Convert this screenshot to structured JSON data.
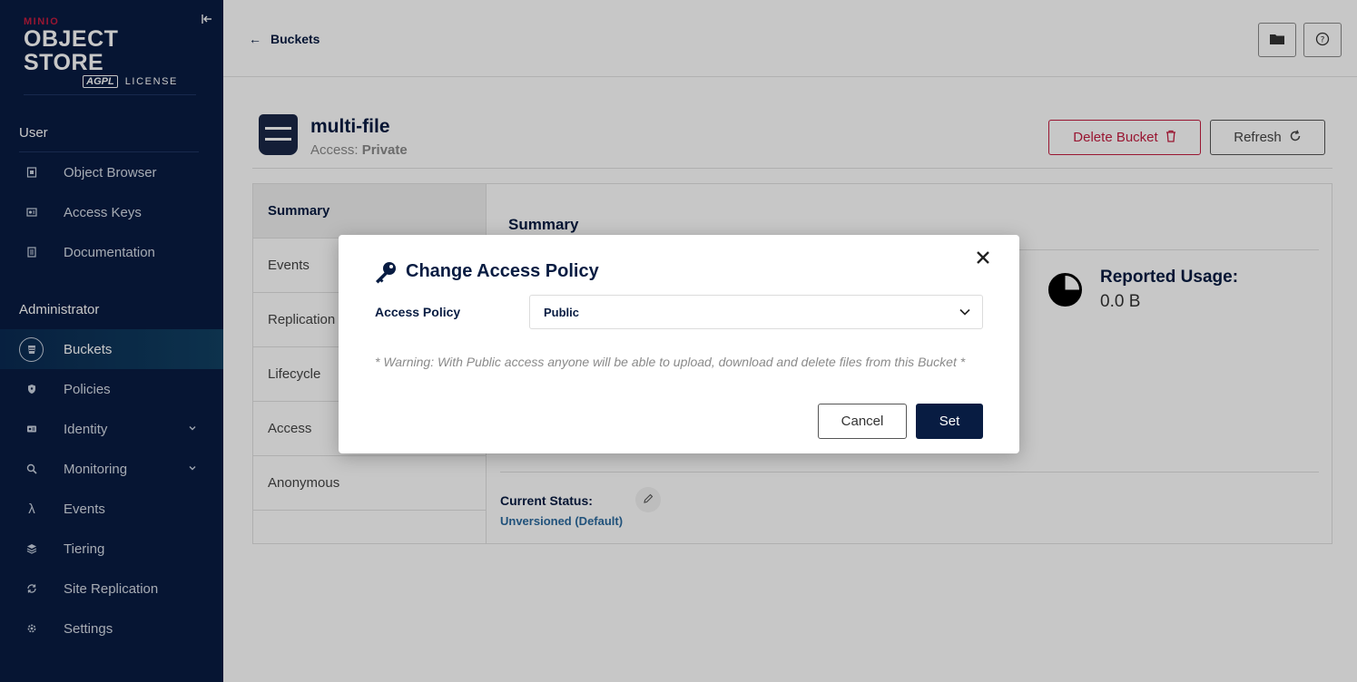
{
  "logo": {
    "brand": "MINIO",
    "product": "OBJECT STORE",
    "license_badge": "AGPL",
    "license_label": "LICENSE"
  },
  "sidebar": {
    "user_section": "User",
    "user_items": [
      {
        "label": "Object Browser",
        "icon": "object-browser-icon"
      },
      {
        "label": "Access Keys",
        "icon": "access-keys-icon"
      },
      {
        "label": "Documentation",
        "icon": "documentation-icon"
      }
    ],
    "admin_section": "Administrator",
    "admin_items": [
      {
        "label": "Buckets",
        "icon": "bucket-icon",
        "active": true
      },
      {
        "label": "Policies",
        "icon": "shield-icon"
      },
      {
        "label": "Identity",
        "icon": "identity-icon",
        "expandable": true
      },
      {
        "label": "Monitoring",
        "icon": "monitoring-icon",
        "expandable": true
      },
      {
        "label": "Events",
        "icon": "lambda-icon"
      },
      {
        "label": "Tiering",
        "icon": "tiers-icon"
      },
      {
        "label": "Site Replication",
        "icon": "replication-icon"
      },
      {
        "label": "Settings",
        "icon": "gear-icon"
      }
    ]
  },
  "topbar": {
    "back_label": "Buckets"
  },
  "bucket": {
    "name": "multi-file",
    "access_label": "Access:",
    "access_value": "Private",
    "delete_label": "Delete Bucket",
    "refresh_label": "Refresh"
  },
  "tabs": [
    "Summary",
    "Events",
    "Replication",
    "Lifecycle",
    "Access",
    "Anonymous"
  ],
  "summary": {
    "title": "Summary",
    "usage_label": "Reported Usage:",
    "usage_value": "0.0 B",
    "status_label": "Current Status:",
    "status_value": "Unversioned (Default)"
  },
  "modal": {
    "title": "Change Access Policy",
    "field_label": "Access Policy",
    "selected_value": "Public",
    "warning": "* Warning: With Public access anyone will be able to upload, download and delete files from this Bucket *",
    "cancel_label": "Cancel",
    "set_label": "Set"
  },
  "colors": {
    "sidebar_bg": "#081c42",
    "danger": "#c51c3f",
    "primary": "#081c42",
    "link": "#2b6a9e"
  }
}
